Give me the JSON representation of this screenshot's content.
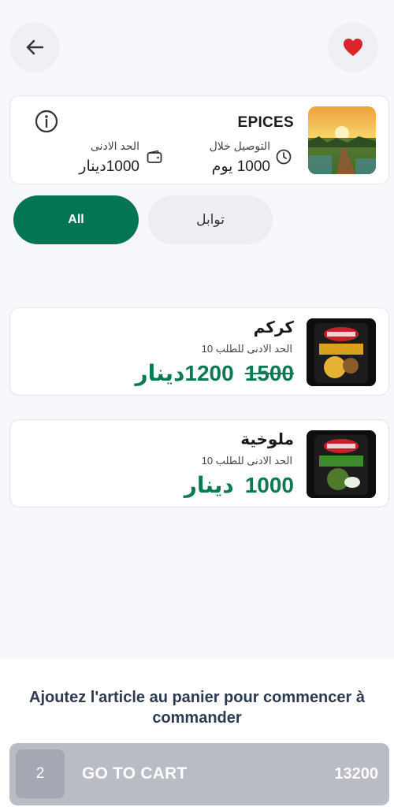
{
  "header": {
    "back_icon": "arrow-left-icon",
    "favorite_icon": "heart-icon"
  },
  "store": {
    "name": "EPICES",
    "delivery_label": "التوصيل خلال",
    "delivery_value": "1000 يوم",
    "minimum_label": "الحد الادنى",
    "minimum_value": "1000دينار"
  },
  "filters": {
    "all_label": "All",
    "spices_label": "توابل"
  },
  "products": [
    {
      "name": "كركم",
      "min_order": "الحد الادنى للطلب 10",
      "price": "1200",
      "currency": "دينار",
      "old_price": "1500"
    },
    {
      "name": "ملوخية",
      "min_order": "الحد الادنى للطلب 10",
      "price": "1000",
      "currency": "دينار"
    }
  ],
  "cart": {
    "hint": "Ajoutez l'article au panier pour commencer à commander",
    "count": "2",
    "label": "GO TO CART",
    "total": "13200"
  },
  "colors": {
    "accent": "#037552",
    "heart": "#d9262e"
  }
}
